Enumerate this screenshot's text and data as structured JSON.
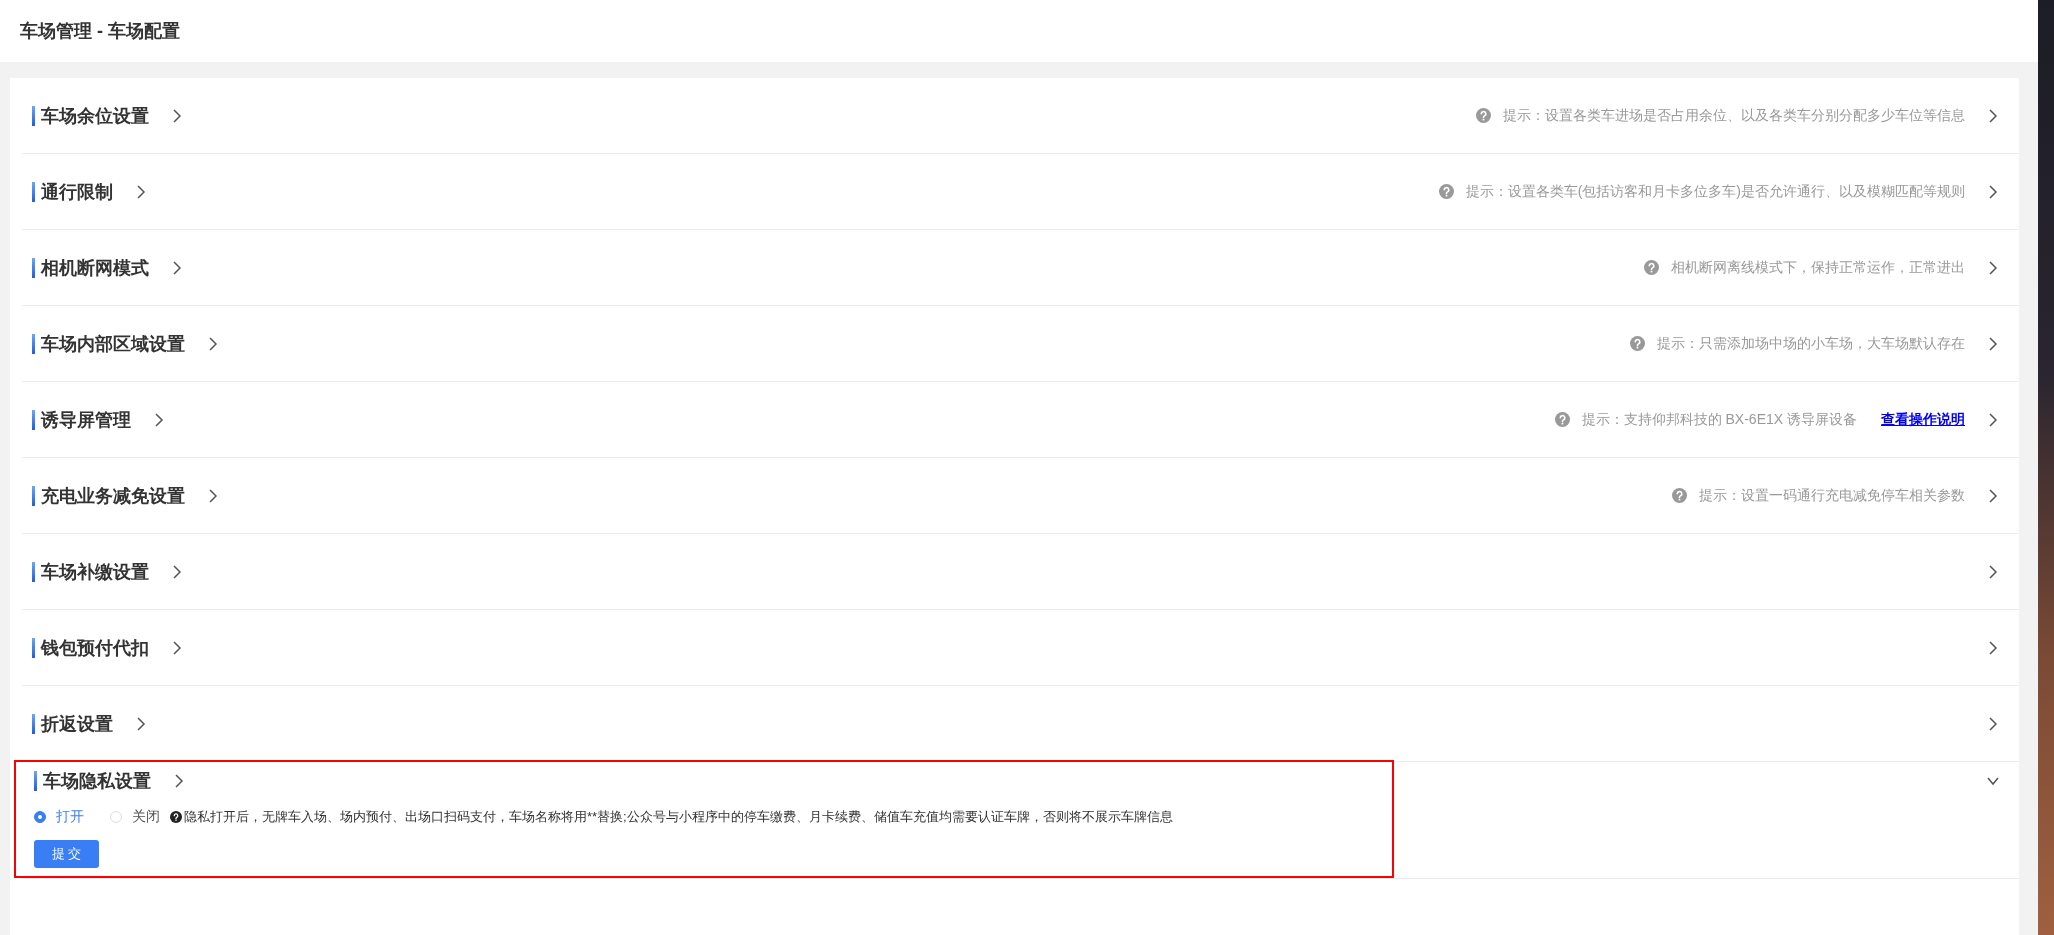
{
  "page": {
    "title": "车场管理 - 车场配置"
  },
  "sections": [
    {
      "title": "车场余位设置",
      "hint": "提示：设置各类车进场是否占用余位、以及各类车分别分配多少车位等信息",
      "expanded": false
    },
    {
      "title": "通行限制",
      "hint": "提示：设置各类车(包括访客和月卡多位多车)是否允许通行、以及模糊匹配等规则",
      "expanded": false
    },
    {
      "title": "相机断网模式",
      "hint": "相机断网离线模式下，保持正常运作，正常进出",
      "expanded": false
    },
    {
      "title": "车场内部区域设置",
      "hint": "提示：只需添加场中场的小车场，大车场默认存在",
      "expanded": false
    },
    {
      "title": "诱导屏管理",
      "hint": "提示：支持仰邦科技的 BX-6E1X 诱导屏设备",
      "link": "查看操作说明",
      "expanded": false
    },
    {
      "title": "充电业务减免设置",
      "hint": "提示：设置一码通行充电减免停车相关参数",
      "expanded": false
    },
    {
      "title": "车场补缴设置",
      "expanded": false
    },
    {
      "title": "钱包预付代扣",
      "expanded": false
    },
    {
      "title": "折返设置",
      "expanded": false
    },
    {
      "title": "车场隐私设置",
      "expanded": true,
      "highlighted": true,
      "options": [
        {
          "label": "打开",
          "selected": true
        },
        {
          "label": "关闭",
          "selected": false
        }
      ],
      "note": "隐私打开后，无牌车入场、场内预付、出场口扫码支付，车场名称将用**替换;公众号与小程序中的停车缴费、月卡续费、储值车充值均需要认证车牌，否则将不展示车牌信息",
      "submit": "提 交"
    }
  ]
}
